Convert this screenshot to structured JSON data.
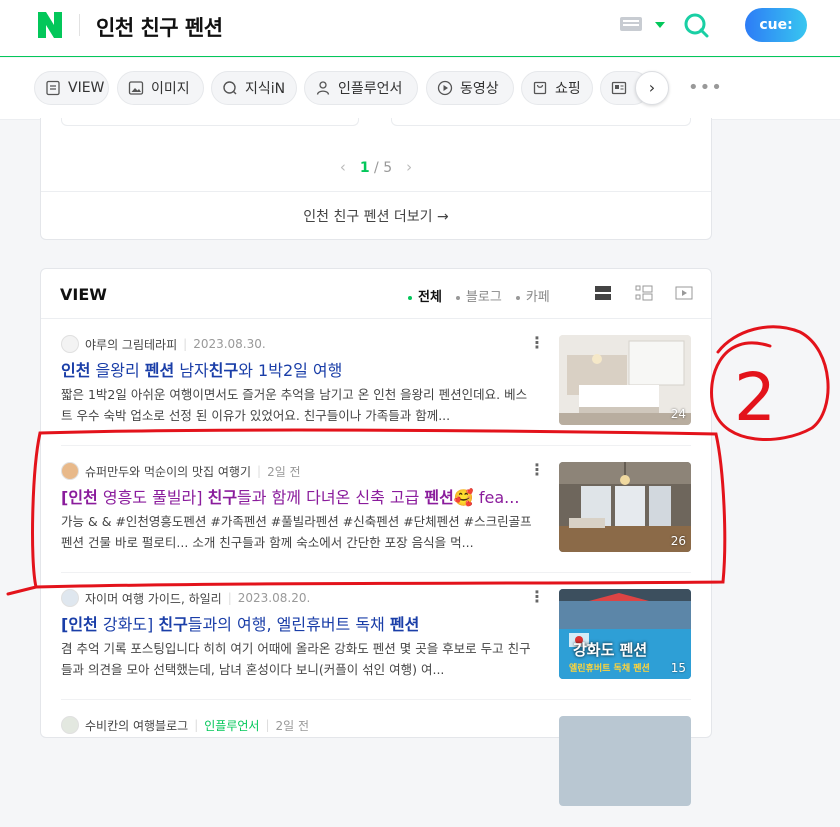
{
  "header": {
    "query": "인천 친구 펜션",
    "cue_label": "cue:"
  },
  "tabs": [
    {
      "label": "VIEW",
      "icon": "document-icon"
    },
    {
      "label": "이미지",
      "icon": "image-icon"
    },
    {
      "label": "지식iN",
      "icon": "q-icon"
    },
    {
      "label": "인플루언서",
      "icon": "person-icon"
    },
    {
      "label": "동영상",
      "icon": "play-icon"
    },
    {
      "label": "쇼핑",
      "icon": "bag-icon"
    },
    {
      "label": "",
      "icon": "news-icon"
    }
  ],
  "pager": {
    "current": "1",
    "sep": "/",
    "total": "5"
  },
  "more_link": "인천 친구 펜션 더보기 →",
  "view": {
    "title": "VIEW",
    "filters": [
      "전체",
      "블로그",
      "카페"
    ],
    "items": [
      {
        "author": "야루의 그림테라피",
        "date": "2023.08.30.",
        "title_parts": [
          "인천",
          " 을왕리 ",
          "펜션",
          " 남자",
          "친구",
          "와 1박2일 여행"
        ],
        "desc": "짧은 1박2일 아쉬운 여행이면서도 즐거운 추억을 남기고 온 인천 을왕리 펜션인데요. 베스트 우수 숙박 업소로 선정 된 이유가 있었어요. 친구들이나 가족들과 함께...",
        "count": "24"
      },
      {
        "author": "슈퍼만두와 먹순이의 맛집 여행기",
        "date": "2일 전",
        "title_parts": [
          "[인천",
          " 영흥도 풀빌라] ",
          "친구",
          "들과 함께 다녀온 신축 고급 ",
          "펜션",
          "🥰 fea..."
        ],
        "desc": "가능 & & #인천영흥도펜션 #가족펜션 #풀빌라펜션 #신축펜션 #단체펜션 #스크린골프펜션 건물 바로 펄로티... 소개 친구들과 함께 숙소에서 간단한 포장 음식을 먹...",
        "count": "26"
      },
      {
        "author": "자이머 여행 가이드, 하일리",
        "date": "2023.08.20.",
        "title_parts": [
          "[인천",
          " 강화도] ",
          "친구",
          "들과의 여행, 엘린휴버트 독채 ",
          "펜션",
          ""
        ],
        "desc": "겸 추억 기록 포스팅입니다 히히 여기 어때에 올라온 강화도 펜션 몇 곳을 후보로 두고 친구들과 의견을 모아 선택했는데, 남녀 혼성이다 보니(커플이 섞인 여행) 여...",
        "count": "15",
        "thumb_text": "강화도 펜션",
        "thumb_sub": "엘린휴버트 독채 펜션"
      },
      {
        "author": "수비칸의 여행블로그",
        "badge": "인플루언서",
        "date": "2일 전"
      }
    ]
  },
  "annotation": {
    "label": "2"
  }
}
